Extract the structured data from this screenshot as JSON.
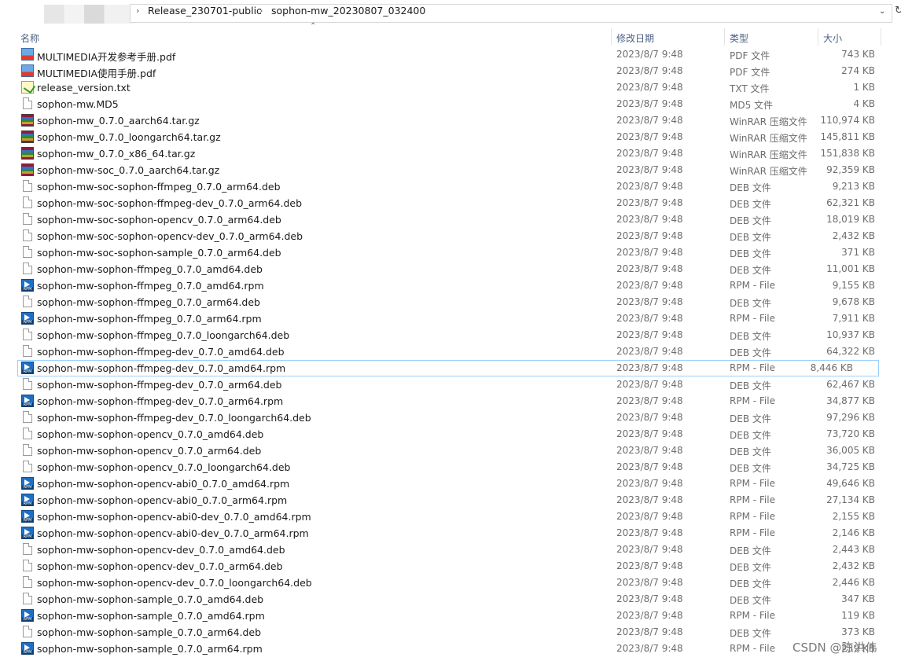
{
  "address_bar": {
    "crumbs": [
      "Release_230701-public",
      "sophon-mw_20230807_032400"
    ]
  },
  "columns": {
    "name": "名称",
    "date": "修改日期",
    "type": "类型",
    "size": "大小"
  },
  "files": [
    {
      "name": "MULTIMEDIA开发参考手册.pdf",
      "date": "2023/8/7 9:48",
      "type": "PDF 文件",
      "size": "743 KB",
      "icon": "pdf-icon"
    },
    {
      "name": "MULTIMEDIA使用手册.pdf",
      "date": "2023/8/7 9:48",
      "type": "PDF 文件",
      "size": "274 KB",
      "icon": "pdf-icon"
    },
    {
      "name": "release_version.txt",
      "date": "2023/8/7 9:48",
      "type": "TXT 文件",
      "size": "1 KB",
      "icon": "txt-icon"
    },
    {
      "name": "sophon-mw.MD5",
      "date": "2023/8/7 9:48",
      "type": "MD5 文件",
      "size": "4 KB",
      "icon": "file-icon"
    },
    {
      "name": "sophon-mw_0.7.0_aarch64.tar.gz",
      "date": "2023/8/7 9:48",
      "type": "WinRAR 压缩文件",
      "size": "110,974 KB",
      "icon": "rar-icon"
    },
    {
      "name": "sophon-mw_0.7.0_loongarch64.tar.gz",
      "date": "2023/8/7 9:48",
      "type": "WinRAR 压缩文件",
      "size": "145,811 KB",
      "icon": "rar-icon"
    },
    {
      "name": "sophon-mw_0.7.0_x86_64.tar.gz",
      "date": "2023/8/7 9:48",
      "type": "WinRAR 压缩文件",
      "size": "151,838 KB",
      "icon": "rar-icon"
    },
    {
      "name": "sophon-mw-soc_0.7.0_aarch64.tar.gz",
      "date": "2023/8/7 9:48",
      "type": "WinRAR 压缩文件",
      "size": "92,359 KB",
      "icon": "rar-icon"
    },
    {
      "name": "sophon-mw-soc-sophon-ffmpeg_0.7.0_arm64.deb",
      "date": "2023/8/7 9:48",
      "type": "DEB 文件",
      "size": "9,213 KB",
      "icon": "file-icon"
    },
    {
      "name": "sophon-mw-soc-sophon-ffmpeg-dev_0.7.0_arm64.deb",
      "date": "2023/8/7 9:48",
      "type": "DEB 文件",
      "size": "62,321 KB",
      "icon": "file-icon"
    },
    {
      "name": "sophon-mw-soc-sophon-opencv_0.7.0_arm64.deb",
      "date": "2023/8/7 9:48",
      "type": "DEB 文件",
      "size": "18,019 KB",
      "icon": "file-icon"
    },
    {
      "name": "sophon-mw-soc-sophon-opencv-dev_0.7.0_arm64.deb",
      "date": "2023/8/7 9:48",
      "type": "DEB 文件",
      "size": "2,432 KB",
      "icon": "file-icon"
    },
    {
      "name": "sophon-mw-soc-sophon-sample_0.7.0_arm64.deb",
      "date": "2023/8/7 9:48",
      "type": "DEB 文件",
      "size": "371 KB",
      "icon": "file-icon"
    },
    {
      "name": "sophon-mw-sophon-ffmpeg_0.7.0_amd64.deb",
      "date": "2023/8/7 9:48",
      "type": "DEB 文件",
      "size": "11,001 KB",
      "icon": "file-icon"
    },
    {
      "name": "sophon-mw-sophon-ffmpeg_0.7.0_amd64.rpm",
      "date": "2023/8/7 9:48",
      "type": "RPM - File",
      "size": "9,155 KB",
      "icon": "rpm-icon"
    },
    {
      "name": "sophon-mw-sophon-ffmpeg_0.7.0_arm64.deb",
      "date": "2023/8/7 9:48",
      "type": "DEB 文件",
      "size": "9,678 KB",
      "icon": "file-icon"
    },
    {
      "name": "sophon-mw-sophon-ffmpeg_0.7.0_arm64.rpm",
      "date": "2023/8/7 9:48",
      "type": "RPM - File",
      "size": "7,911 KB",
      "icon": "rpm-icon"
    },
    {
      "name": "sophon-mw-sophon-ffmpeg_0.7.0_loongarch64.deb",
      "date": "2023/8/7 9:48",
      "type": "DEB 文件",
      "size": "10,937 KB",
      "icon": "file-icon"
    },
    {
      "name": "sophon-mw-sophon-ffmpeg-dev_0.7.0_amd64.deb",
      "date": "2023/8/7 9:48",
      "type": "DEB 文件",
      "size": "64,322 KB",
      "icon": "file-icon"
    },
    {
      "name": "sophon-mw-sophon-ffmpeg-dev_0.7.0_amd64.rpm",
      "date": "2023/8/7 9:48",
      "type": "RPM - File",
      "size": "8,446 KB",
      "icon": "rpm-icon",
      "selected": true
    },
    {
      "name": "sophon-mw-sophon-ffmpeg-dev_0.7.0_arm64.deb",
      "date": "2023/8/7 9:48",
      "type": "DEB 文件",
      "size": "62,467 KB",
      "icon": "file-icon"
    },
    {
      "name": "sophon-mw-sophon-ffmpeg-dev_0.7.0_arm64.rpm",
      "date": "2023/8/7 9:48",
      "type": "RPM - File",
      "size": "34,877 KB",
      "icon": "rpm-icon"
    },
    {
      "name": "sophon-mw-sophon-ffmpeg-dev_0.7.0_loongarch64.deb",
      "date": "2023/8/7 9:48",
      "type": "DEB 文件",
      "size": "97,296 KB",
      "icon": "file-icon"
    },
    {
      "name": "sophon-mw-sophon-opencv_0.7.0_amd64.deb",
      "date": "2023/8/7 9:48",
      "type": "DEB 文件",
      "size": "73,720 KB",
      "icon": "file-icon"
    },
    {
      "name": "sophon-mw-sophon-opencv_0.7.0_arm64.deb",
      "date": "2023/8/7 9:48",
      "type": "DEB 文件",
      "size": "36,005 KB",
      "icon": "file-icon"
    },
    {
      "name": "sophon-mw-sophon-opencv_0.7.0_loongarch64.deb",
      "date": "2023/8/7 9:48",
      "type": "DEB 文件",
      "size": "34,725 KB",
      "icon": "file-icon"
    },
    {
      "name": "sophon-mw-sophon-opencv-abi0_0.7.0_amd64.rpm",
      "date": "2023/8/7 9:48",
      "type": "RPM - File",
      "size": "49,646 KB",
      "icon": "rpm-icon"
    },
    {
      "name": "sophon-mw-sophon-opencv-abi0_0.7.0_arm64.rpm",
      "date": "2023/8/7 9:48",
      "type": "RPM - File",
      "size": "27,134 KB",
      "icon": "rpm-icon"
    },
    {
      "name": "sophon-mw-sophon-opencv-abi0-dev_0.7.0_amd64.rpm",
      "date": "2023/8/7 9:48",
      "type": "RPM - File",
      "size": "2,155 KB",
      "icon": "rpm-icon"
    },
    {
      "name": "sophon-mw-sophon-opencv-abi0-dev_0.7.0_arm64.rpm",
      "date": "2023/8/7 9:48",
      "type": "RPM - File",
      "size": "2,146 KB",
      "icon": "rpm-icon"
    },
    {
      "name": "sophon-mw-sophon-opencv-dev_0.7.0_amd64.deb",
      "date": "2023/8/7 9:48",
      "type": "DEB 文件",
      "size": "2,443 KB",
      "icon": "file-icon"
    },
    {
      "name": "sophon-mw-sophon-opencv-dev_0.7.0_arm64.deb",
      "date": "2023/8/7 9:48",
      "type": "DEB 文件",
      "size": "2,432 KB",
      "icon": "file-icon"
    },
    {
      "name": "sophon-mw-sophon-opencv-dev_0.7.0_loongarch64.deb",
      "date": "2023/8/7 9:48",
      "type": "DEB 文件",
      "size": "2,446 KB",
      "icon": "file-icon"
    },
    {
      "name": "sophon-mw-sophon-sample_0.7.0_amd64.deb",
      "date": "2023/8/7 9:48",
      "type": "DEB 文件",
      "size": "347 KB",
      "icon": "file-icon"
    },
    {
      "name": "sophon-mw-sophon-sample_0.7.0_amd64.rpm",
      "date": "2023/8/7 9:48",
      "type": "RPM - File",
      "size": "119 KB",
      "icon": "rpm-icon"
    },
    {
      "name": "sophon-mw-sophon-sample_0.7.0_arm64.deb",
      "date": "2023/8/7 9:48",
      "type": "DEB 文件",
      "size": "373 KB",
      "icon": "file-icon"
    },
    {
      "name": "sophon-mw-sophon-sample_0.7.0_arm64.rpm",
      "date": "2023/8/7 9:48",
      "type": "RPM - File",
      "size": "239 KB",
      "icon": "rpm-icon"
    }
  ],
  "watermark": "CSDN @陈洪伟"
}
